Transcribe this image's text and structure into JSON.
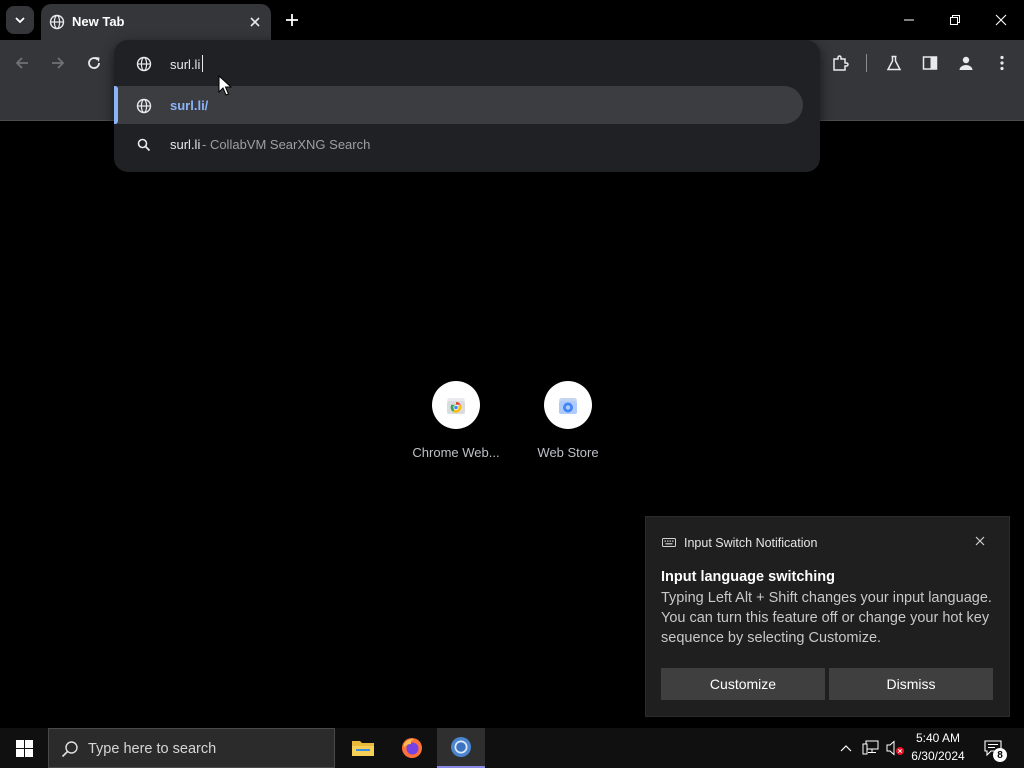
{
  "browser": {
    "tab": {
      "title": "New Tab"
    },
    "omnibox": {
      "input_value": "surl.li",
      "suggestions": [
        {
          "type": "url",
          "icon": "globe-icon",
          "text": "surl.li/"
        },
        {
          "type": "search",
          "icon": "search-icon",
          "query": "surl.li",
          "description": "- CollabVM SearXNG Search"
        }
      ]
    },
    "shortcuts": [
      {
        "label": "Chrome Web...",
        "icon": "chrome-web-store-icon"
      },
      {
        "label": "Web Store",
        "icon": "web-store-icon"
      }
    ]
  },
  "toast": {
    "app_name": "Input Switch Notification",
    "title": "Input language switching",
    "body": "Typing Left Alt + Shift changes your input language. You can turn this feature off or change your hot key sequence by selecting Customize.",
    "buttons": {
      "customize": "Customize",
      "dismiss": "Dismiss"
    }
  },
  "taskbar": {
    "search_placeholder": "Type here to search",
    "time": "5:40 AM",
    "date": "6/30/2024",
    "notification_count": "8"
  },
  "colors": {
    "accent_link": "#8ab4f8",
    "toolbar_bg": "#35363a",
    "omnibox_bg": "#202124"
  }
}
